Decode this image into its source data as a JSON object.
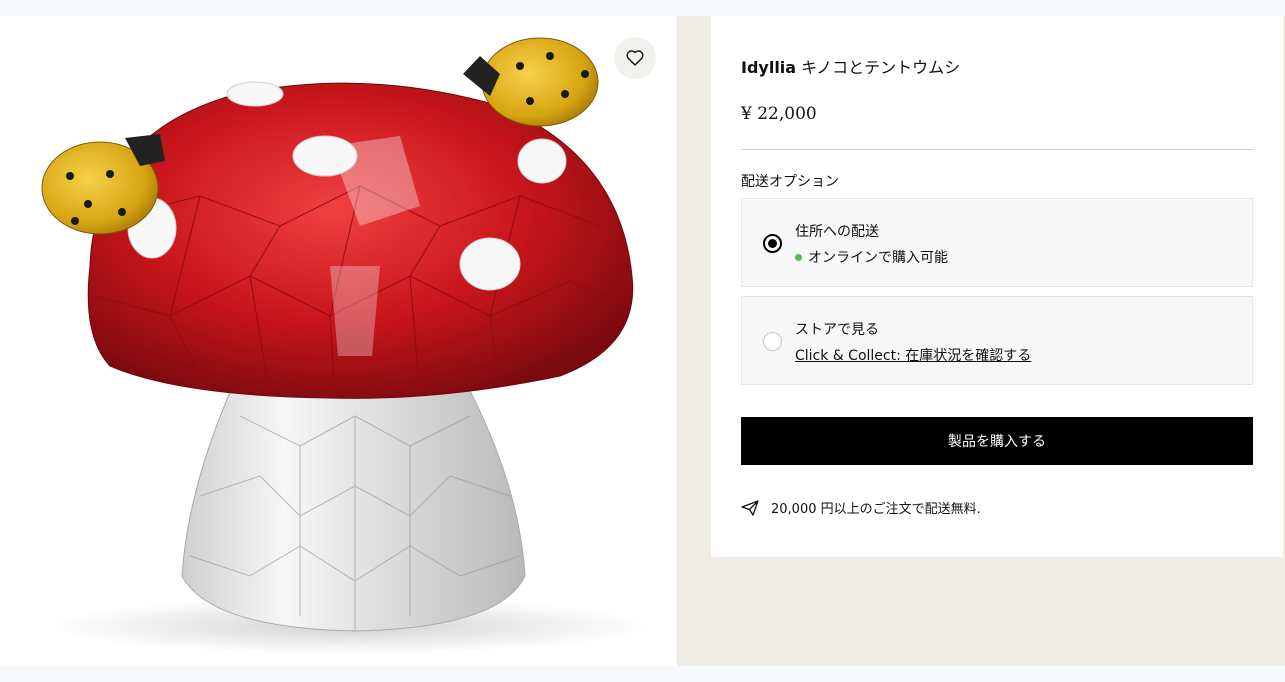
{
  "product": {
    "brand": "Idyllia",
    "name": "キノコとテントウムシ",
    "price": "¥ 22,000",
    "image_icon": "crystal-mushroom-figurine"
  },
  "wishlist": {
    "icon": "heart-icon"
  },
  "delivery": {
    "heading": "配送オプション",
    "options": [
      {
        "title": "住所への配送",
        "status": "オンラインで購入可能",
        "status_color": "#5cb85c",
        "selected": true
      },
      {
        "title": "ストアで見る",
        "link": "Click & Collect: 在庫状況を確認する",
        "selected": false
      }
    ]
  },
  "buy_button": {
    "label": "製品を購入する"
  },
  "shipping_note": {
    "icon": "paper-plane-icon",
    "text": "20,000 円以上のご注文で配送無料."
  },
  "colors": {
    "accent": "#000000",
    "panel_bg": "#efece6",
    "mushroom_red": "#c8151b"
  }
}
